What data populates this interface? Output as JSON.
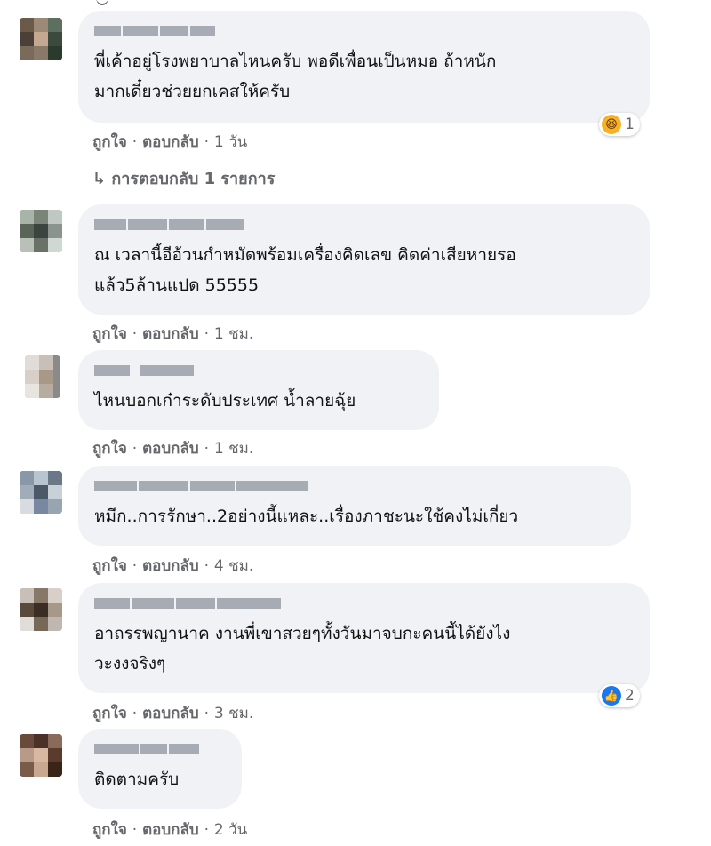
{
  "ui": {
    "like": "ถูกใจ",
    "reply": "ตอบกลับ",
    "separator": "·",
    "reply_arrow": "↳"
  },
  "comments": [
    {
      "text": "พี่เค้าอยู่โรงพยาบาลไหนครับ พอดีเพื่อนเป็นหมอ ถ้าหนัก\nมากเดี๋ยวช่วยยกเคสให้ครับ",
      "time": "1 วัน",
      "reaction": {
        "icon": "haha-icon",
        "count": "1"
      },
      "replies_text": "การตอบกลับ 1 รายการ"
    },
    {
      "text": "ณ เวลานี้อีอ้วนกำหมัดพร้อมเครื่องคิดเลข คิดค่าเสียหายรอ\nแล้ว5ล้านแปด 55555",
      "time": "1 ชม."
    },
    {
      "text": "ไหนบอกเก๋าระดับประเทศ น้ำลายฉุ้ย",
      "time": "1 ชม."
    },
    {
      "text": "หมึก..การรักษา..2อย่างนี้แหละ..เรื่องภาชะนะใช้คงไม่เกี่ยว",
      "time": "4 ชม."
    },
    {
      "text": "อาถรรพญานาค งานพี่เขาสวยๆทั้งวันมาจบกะคนนี้ได้ยังไง\nวะงงจริงๆ",
      "time": "3 ชม.",
      "reaction": {
        "icon": "like-icon",
        "count": "2"
      }
    },
    {
      "text": "ติดตามครับ",
      "time": "2 วัน"
    }
  ],
  "colors": {
    "bubble": "#f0f2f5",
    "meta": "#65676b",
    "like_blue": "#1877f2",
    "haha_yellow": "#f7b125"
  }
}
